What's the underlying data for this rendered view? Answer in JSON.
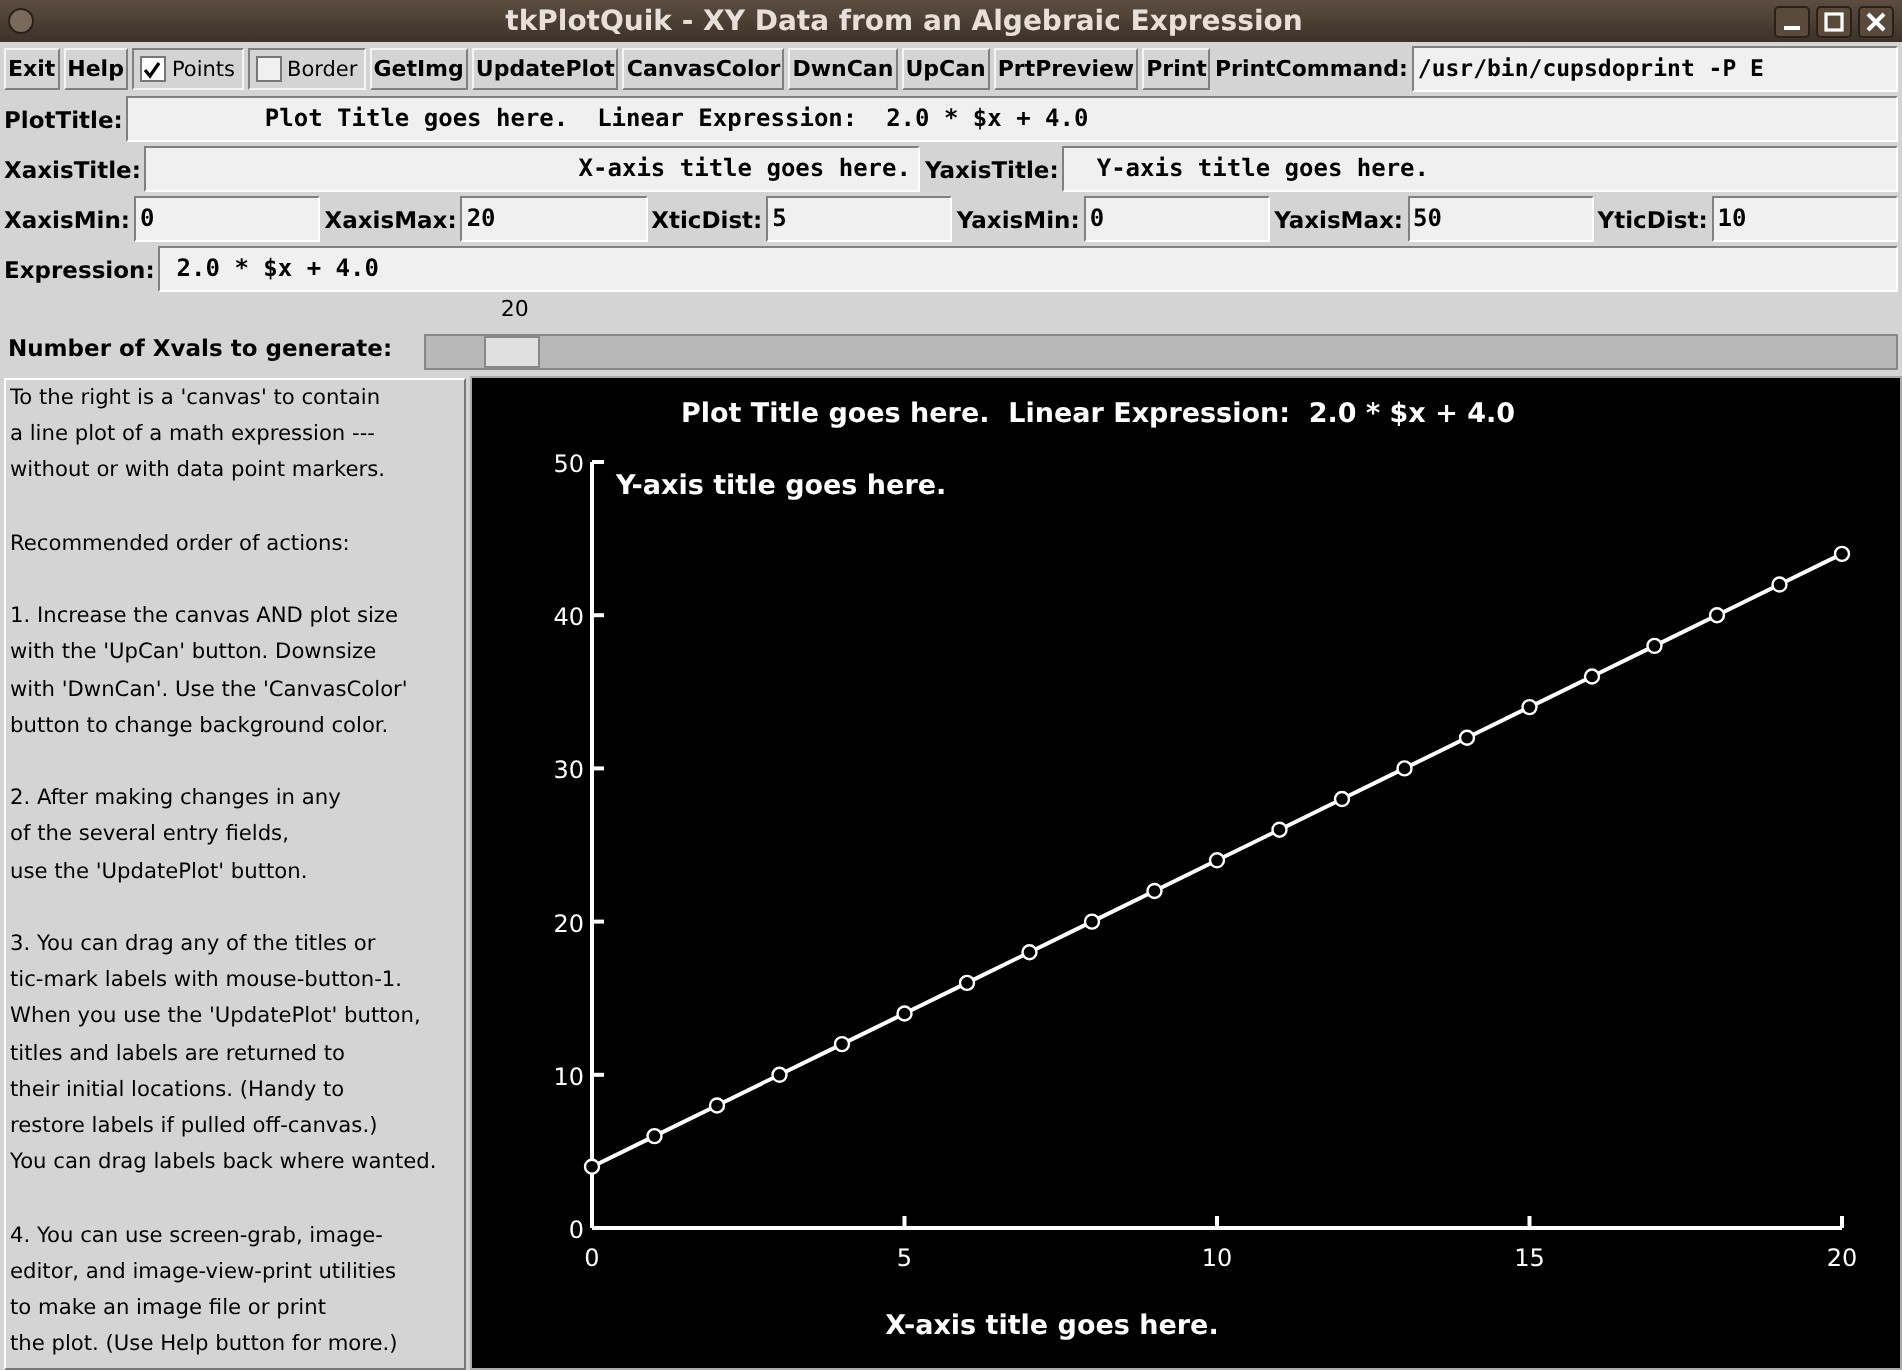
{
  "window": {
    "title": "tkPlotQuik - XY Data from an Algebraic Expression"
  },
  "toolbar": [
    {
      "kind": "button",
      "label": "Exit"
    },
    {
      "kind": "button",
      "label": "Help"
    },
    {
      "kind": "checkbox",
      "label": "Points",
      "checked": true
    },
    {
      "kind": "checkbox",
      "label": "Border",
      "checked": false
    },
    {
      "kind": "button",
      "label": "GetImg"
    },
    {
      "kind": "button",
      "label": "UpdatePlot"
    },
    {
      "kind": "button",
      "label": "CanvasColor"
    },
    {
      "kind": "button",
      "label": "DwnCan"
    },
    {
      "kind": "button",
      "label": "UpCan"
    },
    {
      "kind": "button",
      "label": "PrtPreview"
    },
    {
      "kind": "button",
      "label": "Print"
    },
    {
      "kind": "label",
      "label": "PrintCommand:"
    },
    {
      "kind": "entry",
      "value": "/usr/bin/cupsdoprint -P E"
    }
  ],
  "plot_title": {
    "label": "PlotTitle:",
    "value": "Plot Title goes here.  Linear Expression:  2.0 * $x + 4.0"
  },
  "axis_titles": [
    {
      "label": "XaxisTitle:",
      "value": "X-axis title goes here."
    },
    {
      "label": "YaxisTitle:",
      "value": "Y-axis title goes here."
    }
  ],
  "axis_limits": [
    {
      "label": "XaxisMin:",
      "value": "0"
    },
    {
      "label": "XaxisMax:",
      "value": "20"
    },
    {
      "label": "XticDist:",
      "value": "5"
    },
    {
      "label": "YaxisMin:",
      "value": "0"
    },
    {
      "label": "YaxisMax:",
      "value": "50"
    },
    {
      "label": "YticDist:",
      "value": "10"
    }
  ],
  "expression": {
    "label": "Expression:",
    "value": "2.0 * $x + 4.0"
  },
  "slider": {
    "label": "Number of Xvals to generate:",
    "reading": "20",
    "level": 0.04
  },
  "help_text": [
    "To the right is a 'canvas' to contain\na line plot of a math expression ---\nwithout or with data point markers.",
    "Recommended order of actions:",
    "1. Increase the canvas AND plot size\nwith the 'UpCan' button. Downsize\nwith 'DwnCan'. Use the 'CanvasColor'\nbutton to change background color.",
    "2. After making changes in any\nof the several entry fields,\nuse the 'UpdatePlot' button.",
    "3. You can drag any of the titles or\ntic-mark labels with mouse-button-1.\nWhen you use the 'UpdatePlot' button,\ntitles and labels are returned to\ntheir initial locations. (Handy to\nrestore labels if pulled off-canvas.)\nYou can drag labels back where wanted.",
    "4. You can use screen-grab, image-\neditor, and image-view-print utilities\nto make an image file or print\nthe plot. (Use Help button for more.)"
  ],
  "canvas": {
    "title": "Plot Title goes here.  Linear Expression:  2.0 * $x + 4.0",
    "y_title": "Y-axis title goes here.",
    "x_title": "X-axis title goes here.",
    "chart_data": {
      "type": "line",
      "x": [
        0,
        1,
        2,
        3,
        4,
        5,
        6,
        7,
        8,
        9,
        10,
        11,
        12,
        13,
        14,
        15,
        16,
        17,
        18,
        19,
        20
      ],
      "series": [
        {
          "color": "#ffffff",
          "marker": "circle",
          "values": [
            4,
            6,
            8,
            10,
            12,
            14,
            16,
            18,
            20,
            22,
            24,
            26,
            28,
            30,
            32,
            34,
            36,
            38,
            40,
            42,
            44
          ]
        }
      ],
      "xlim": [
        0,
        20
      ],
      "ylim": [
        0,
        50
      ],
      "xticks": [
        0,
        5,
        10,
        15,
        20
      ],
      "yticks": [
        0,
        10,
        20,
        30,
        40,
        50
      ]
    }
  }
}
